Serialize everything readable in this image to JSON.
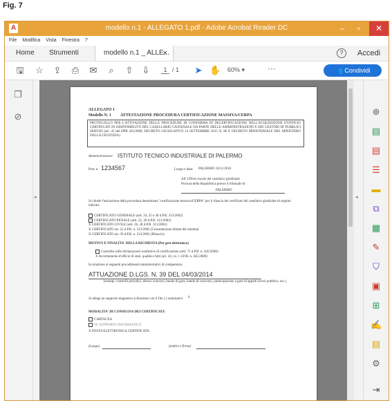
{
  "figure_label": "Fig. 7",
  "window": {
    "app_icon": "acrobat-icon",
    "title": "modello n.1 - ALLEGATO 1.pdf - Adobe Acrobat Reader DC",
    "minimize": "–",
    "maximize": "▫",
    "close": "✕"
  },
  "menu": [
    "File",
    "Modifica",
    "Vista",
    "Finestra",
    "?"
  ],
  "tabs": {
    "home": "Home",
    "tools": "Strumenti",
    "doc": "modello n.1 _ ALLE...",
    "doc_close": "×",
    "help": "?",
    "signin": "Accedi"
  },
  "toolbar": {
    "page_current": "1",
    "page_total": "/ 1",
    "zoom": "60%",
    "more": "···",
    "share_label": "Condividi"
  },
  "document": {
    "allegato": "ALLEGATO 1",
    "modello": "Modello N. 1",
    "header_title": "ATTESTAZIONE PROCEDURA CERTIFICAZIONE MASSIVA/CERPA",
    "box_text": "PROTOCOLLO PER L'ATTIVAZIONE DELLE PROCEDURE DI CONFERMA DI DECERTIFICAZIONE NELL'ACQUISIZIONE D'UFFICIO CERTIFICATI IN DISPONIBILITÀ DEL CASELLARIO GIUDIZIALE DA PARTE DELLE AMMINISTRAZIONI E DEI GESTORI DI PUBBLICI SERVIZI (art. 43 del DPR 445/2000, DECRETO LEGISLATIVO 14 SETTEMBRE 2015 N. 80 E DECRETO MINISTERIALE DEL MINISTERO DELLA GIUSTIZIA)",
    "amm_label": "Amministrazione:",
    "amm_value": "ISTITUTO TECNICO INDUSTRIALE DI PALERMO",
    "prot_label": "Prot. n.",
    "prot_value": "1234567",
    "date_label": "Luogo e data:",
    "date_value": "PALERMO 10/11/2016",
    "to_line1": "All' Ufficio locale del casellario giudiziale",
    "to_line2": "Procura della Repubblica presso il tribunale di",
    "to_line3": "PALERMO",
    "request": "Si chiede l'attivazione della procedura denominata \"certificazione massiva/CERPA\" per il rilascio dei certificati del casellario giudiziale di seguito indicati:",
    "options": [
      {
        "mark": "",
        "text": "CERTIFICATO GENERALE (artt. 24, 25 e 28 d.P.R. 313/2002)"
      },
      {
        "mark": "",
        "text": "CERTIFICATO PENALE (artt. 25, 28 d.P.R. 313/2002)"
      },
      {
        "mark": "X",
        "text": "CERTIFICATO CIVILE (artt. 26, 28 d.P.R. 313/2002)"
      },
      {
        "mark": "X",
        "text": "CERTIFICATO art. 25 d.P.R. n. 313/2002 (Consultazione diretta del sistema)"
      },
      {
        "mark": "X",
        "text": "CERTIFICATO art. 39 d.P.R. n. 313/2002 (Rilascio)"
      }
    ],
    "motivo_title": "MOTIVO E FINALITA' DELLA RICHIESTA (Per gest elettronico)",
    "motivi": [
      {
        "mark": "",
        "text": "Controllo sulle dichiarazioni sostitutive di certificazione (artt. 71 d.P.R. n. 445/2000)"
      },
      {
        "mark": "X",
        "text": "Accertamento d'ufficio di stati, qualità e fatti (art. 43, co. 1 d.P.R. n. 445/2000)"
      }
    ],
    "relazione": "In relazione ai seguenti procedimenti amministrativi di competenza:",
    "attuazione": "ATTUAZIONE D.LGS. N. 39 DEL 04/03/2014",
    "attuazione_note": "(esempi: controlli periodici, elenco concorsi, bando di gara, bando di concorso, partecipazione a gare di appalti lavori pubblici, ecc.)",
    "allega": "Si allega un supporto magnetico (chiavetta) con il file (    )       nominativi.",
    "allega_count": "6",
    "modalita_title": "MODALITA' DI CONSEGNA DEI CERTIFICATI:",
    "consegna": [
      {
        "mark": "",
        "text": "CARTACEA"
      },
      {
        "mark": "",
        "text": "SU SUPPORTO INFORMATICO"
      },
      {
        "mark": "X",
        "text": "POSTA ELETTRONICA CERTIFICATA"
      }
    ],
    "sign_luogo": "(Luogo)",
    "sign_timbro": "(timbro e firma)"
  }
}
